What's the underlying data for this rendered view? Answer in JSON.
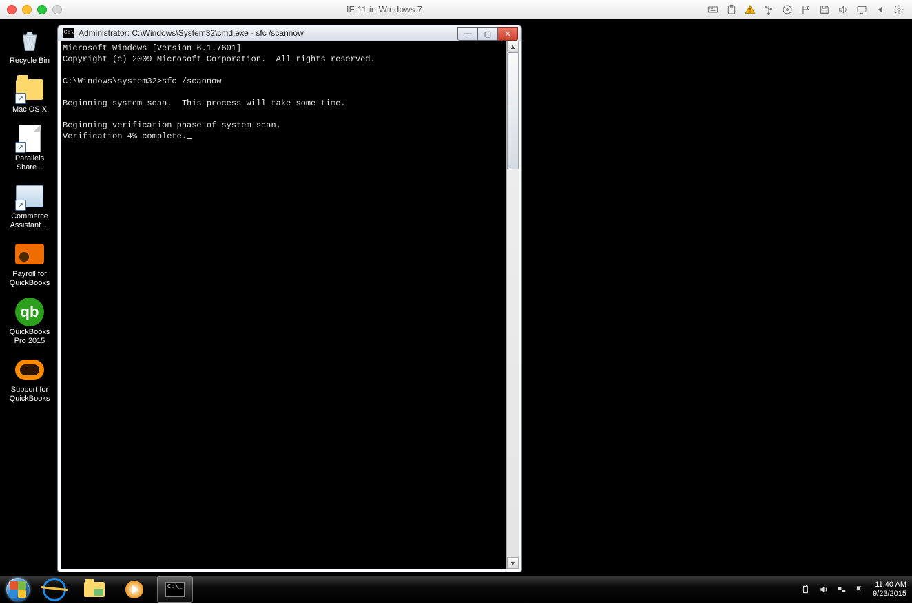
{
  "mac_bar": {
    "title": "IE 11 in Windows 7",
    "icons": [
      "keyboard",
      "clipboard",
      "warning",
      "usb",
      "disc",
      "flag",
      "floppy",
      "sound",
      "display",
      "back",
      "gear"
    ]
  },
  "desktop_icons": [
    {
      "id": "recycle-bin",
      "label": "Recycle Bin"
    },
    {
      "id": "mac-os-x",
      "label": "Mac OS X"
    },
    {
      "id": "parallels-share",
      "label": "Parallels\nShare..."
    },
    {
      "id": "commerce-assistant",
      "label": "Commerce\nAssistant ..."
    },
    {
      "id": "payroll-qb",
      "label": "Payroll for\nQuickBooks"
    },
    {
      "id": "quickbooks-pro",
      "label": "QuickBooks\nPro 2015"
    },
    {
      "id": "support-qb",
      "label": "Support for\nQuickBooks"
    }
  ],
  "cmd_window": {
    "title": "Administrator: C:\\Windows\\System32\\cmd.exe - sfc  /scannow",
    "lines": [
      "Microsoft Windows [Version 6.1.7601]",
      "Copyright (c) 2009 Microsoft Corporation.  All rights reserved.",
      "",
      "C:\\Windows\\system32>sfc /scannow",
      "",
      "Beginning system scan.  This process will take some time.",
      "",
      "Beginning verification phase of system scan.",
      "Verification 4% complete."
    ]
  },
  "taskbar": {
    "pinned": [
      "start",
      "internet-explorer",
      "file-explorer",
      "windows-media-player",
      "cmd"
    ],
    "tray_icons": [
      "power",
      "volume",
      "network",
      "action-center"
    ],
    "clock_time": "11:40 AM",
    "clock_date": "9/23/2015"
  }
}
